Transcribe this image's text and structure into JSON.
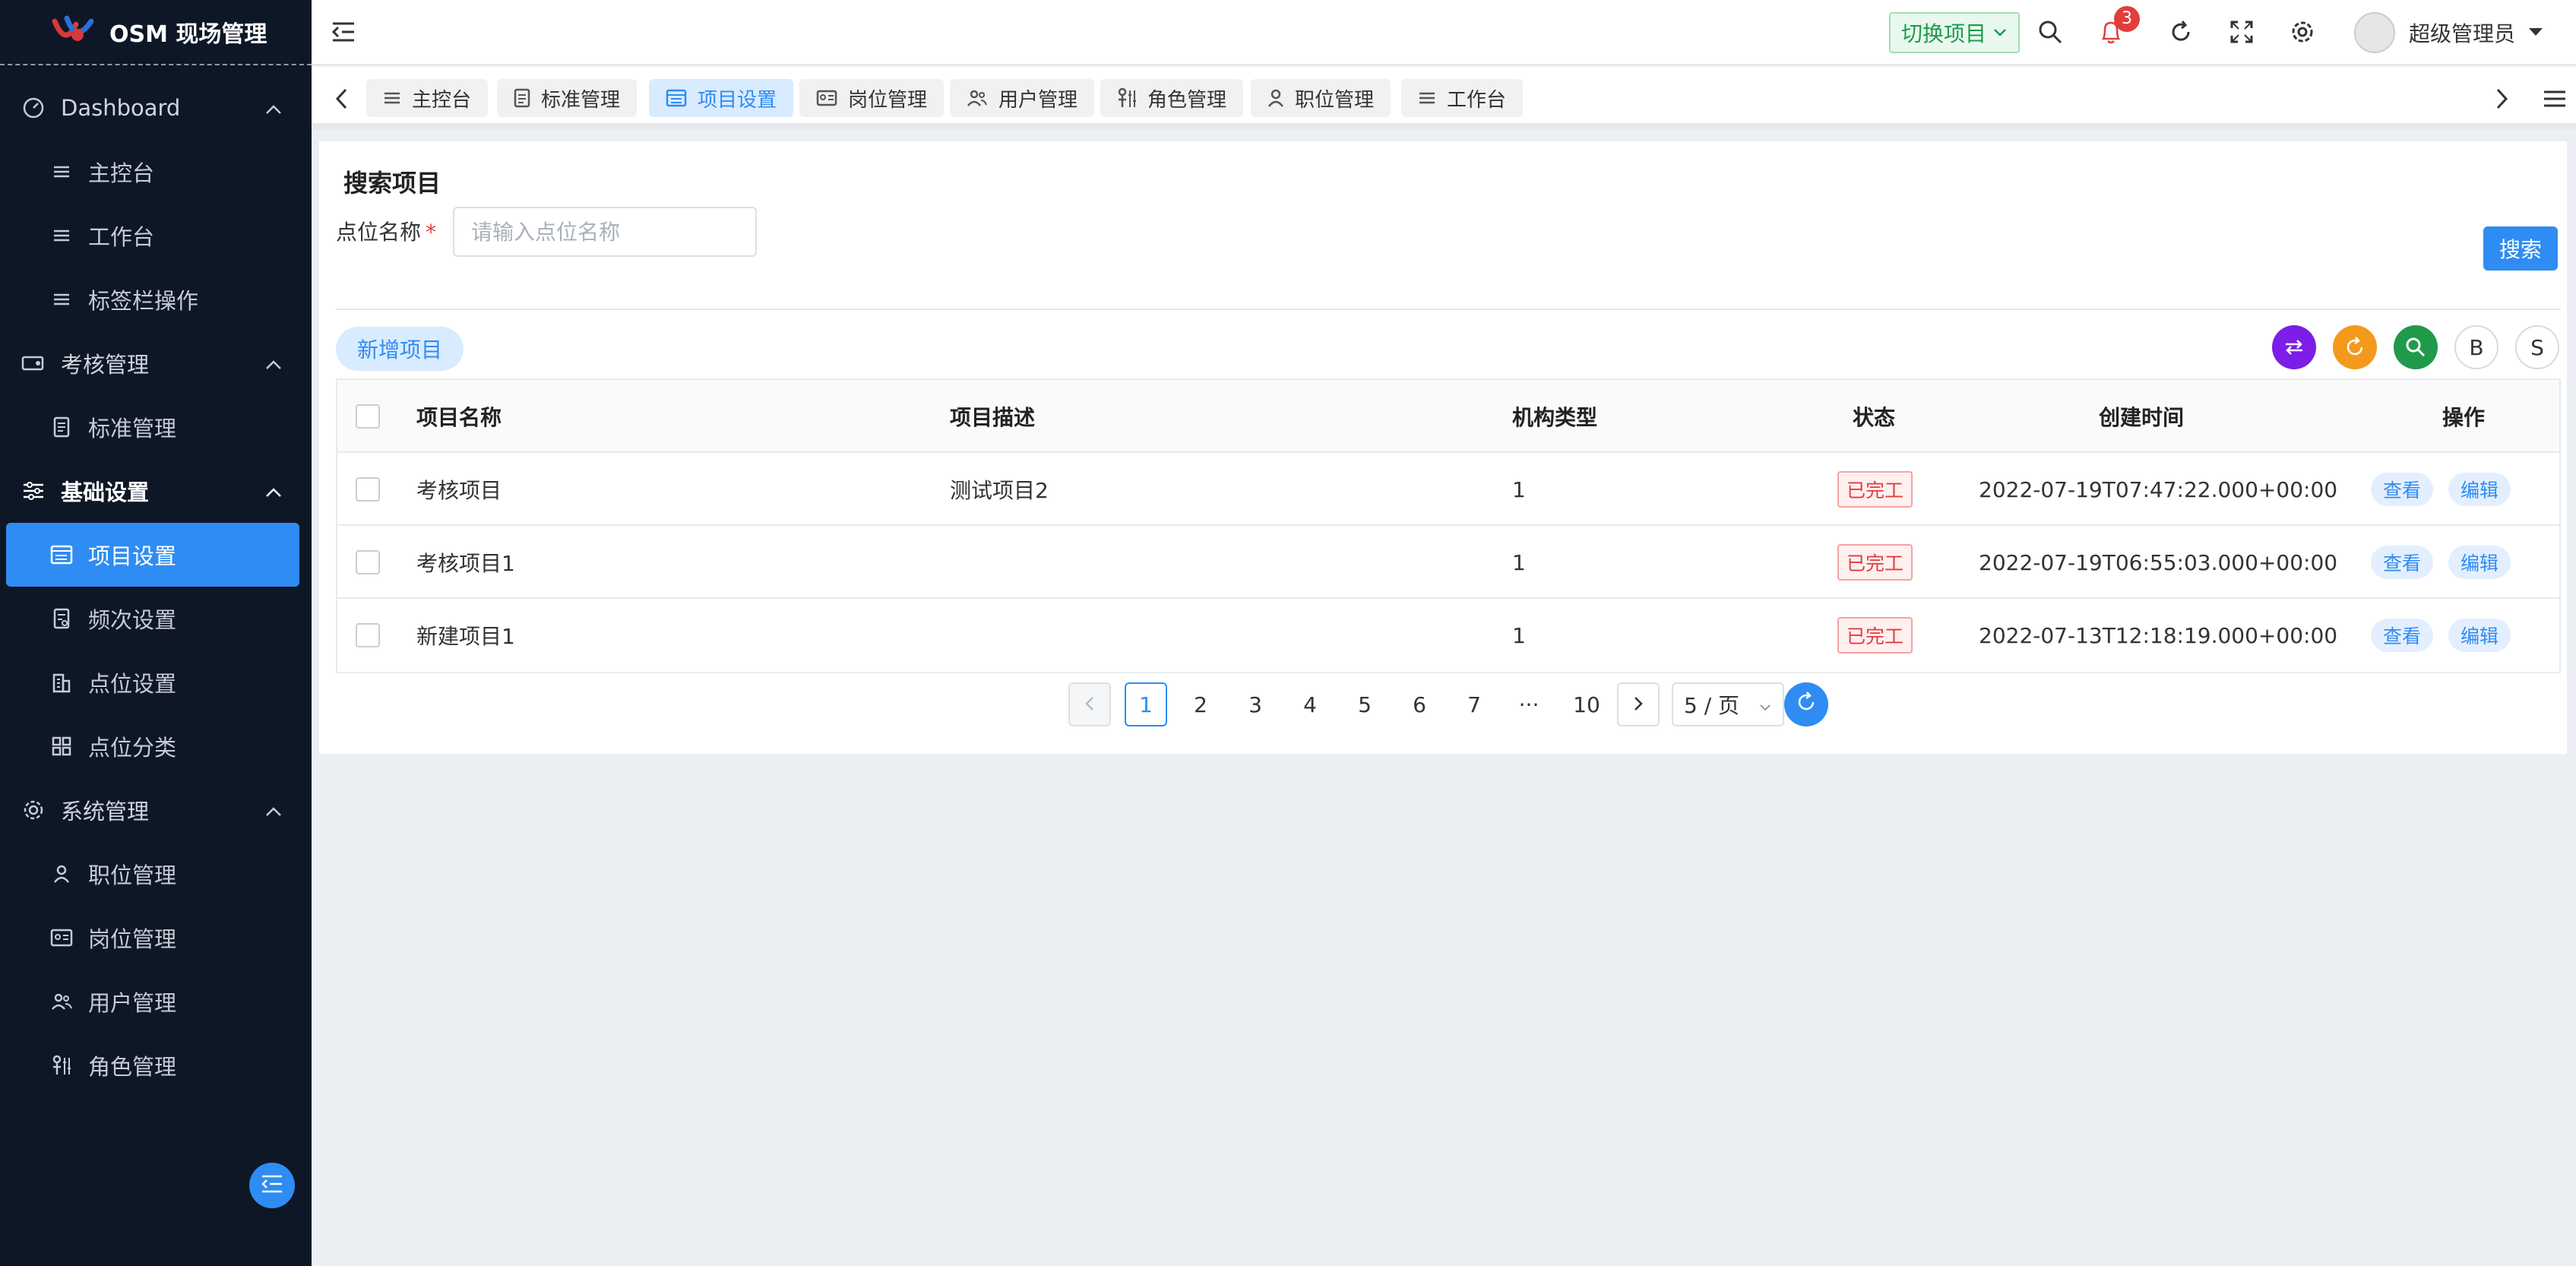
{
  "app": {
    "title": "OSM 现场管理"
  },
  "sidebar": {
    "groups": [
      {
        "label": "Dashboard",
        "items": [
          {
            "label": "主控台"
          },
          {
            "label": "工作台"
          },
          {
            "label": "标签栏操作"
          }
        ]
      },
      {
        "label": "考核管理",
        "items": [
          {
            "label": "标准管理"
          }
        ]
      },
      {
        "label": "基础设置",
        "items": [
          {
            "label": "项目设置"
          },
          {
            "label": "频次设置"
          },
          {
            "label": "点位设置"
          },
          {
            "label": "点位分类"
          }
        ]
      },
      {
        "label": "系统管理",
        "items": [
          {
            "label": "职位管理"
          },
          {
            "label": "岗位管理"
          },
          {
            "label": "用户管理"
          },
          {
            "label": "角色管理"
          }
        ]
      }
    ]
  },
  "header": {
    "switch_label": "切换项目",
    "notification_count": "3",
    "user_name": "超级管理员"
  },
  "tabs": [
    {
      "label": "主控台",
      "icon": "list-icon"
    },
    {
      "label": "标准管理",
      "icon": "document-icon"
    },
    {
      "label": "项目设置",
      "icon": "form-icon"
    },
    {
      "label": "岗位管理",
      "icon": "id-card-icon"
    },
    {
      "label": "用户管理",
      "icon": "users-icon"
    },
    {
      "label": "角色管理",
      "icon": "role-icon"
    },
    {
      "label": "职位管理",
      "icon": "person-icon"
    },
    {
      "label": "工作台",
      "icon": "list-icon"
    }
  ],
  "search": {
    "title": "搜索项目",
    "field_label": "点位名称",
    "required_mark": "*",
    "placeholder": "请输入点位名称",
    "button_label": "搜索"
  },
  "toolbar": {
    "add_label": "新增项目",
    "b_label": "B",
    "s_label": "S",
    "colors": {
      "purple": "#7c1de8",
      "orange": "#f39a1c",
      "green": "#1f9a4b"
    }
  },
  "table": {
    "headers": {
      "name": "项目名称",
      "desc": "项目描述",
      "org_type": "机构类型",
      "status": "状态",
      "created": "创建时间",
      "ops": "操作"
    },
    "rows": [
      {
        "name": "考核项目",
        "desc": "测试项目2",
        "org_type": "1",
        "status": "已完工",
        "created": "2022-07-19T07:47:22.000+00:00",
        "view": "查看",
        "edit": "编辑"
      },
      {
        "name": "考核项目1",
        "desc": "",
        "org_type": "1",
        "status": "已完工",
        "created": "2022-07-19T06:55:03.000+00:00",
        "view": "查看",
        "edit": "编辑"
      },
      {
        "name": "新建项目1",
        "desc": "",
        "org_type": "1",
        "status": "已完工",
        "created": "2022-07-13T12:18:19.000+00:00",
        "view": "查看",
        "edit": "编辑"
      }
    ]
  },
  "pagination": {
    "pages": [
      "1",
      "2",
      "3",
      "4",
      "5",
      "6",
      "7",
      "···",
      "10"
    ],
    "current": "1",
    "page_size": "5 / 页"
  },
  "colors": {
    "sidebar_bg": "#0e1726",
    "accent": "#2f8cf2",
    "danger": "#e23c3c",
    "success": "#1f9a4b"
  }
}
